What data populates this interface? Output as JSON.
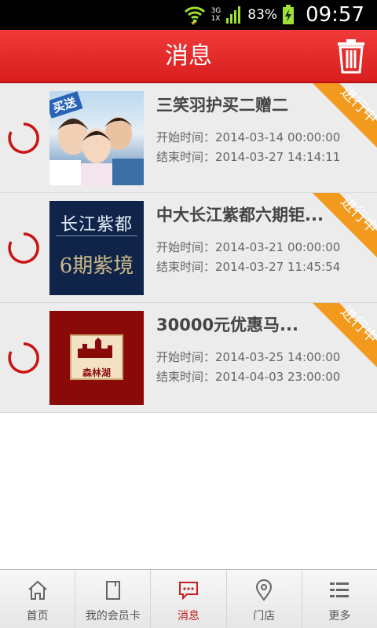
{
  "status_bar": {
    "network": "3G",
    "network2": "1X",
    "battery": "83%",
    "time": "09:57"
  },
  "header": {
    "title": "消息",
    "delete_icon": "trash-icon"
  },
  "messages": [
    {
      "name": "三笑羽护买二赠二",
      "start": "开始时间：2014-03-14 00:00:00",
      "end": "结束时间：2014-03-27 14:14:11",
      "badge": "进行中",
      "thumb_text": "买送"
    },
    {
      "name": "中大长江紫都六期钜...",
      "start": "开始时间：2014-03-21 00:00:00",
      "end": "结束时间：2014-03-27 11:45:54",
      "badge": "进行中",
      "thumb_text": "长江紫都",
      "thumb_text2": "6期紫境"
    },
    {
      "name": "30000元优惠马...",
      "start": "开始时间：2014-03-25 14:00:00",
      "end": "结束时间：2014-04-03 23:00:00",
      "badge": "进行中",
      "thumb_text": "森林湖"
    }
  ],
  "tabs": [
    {
      "label": "首页",
      "icon": "home-icon"
    },
    {
      "label": "我的会员卡",
      "icon": "card-icon"
    },
    {
      "label": "消息",
      "icon": "message-icon",
      "active": true
    },
    {
      "label": "门店",
      "icon": "location-pin-icon"
    },
    {
      "label": "更多",
      "icon": "more-grid-icon"
    }
  ],
  "colors": {
    "header_red": "#e02a2a",
    "badge_orange": "#f39a1e",
    "active_tab": "#c81e1e"
  }
}
